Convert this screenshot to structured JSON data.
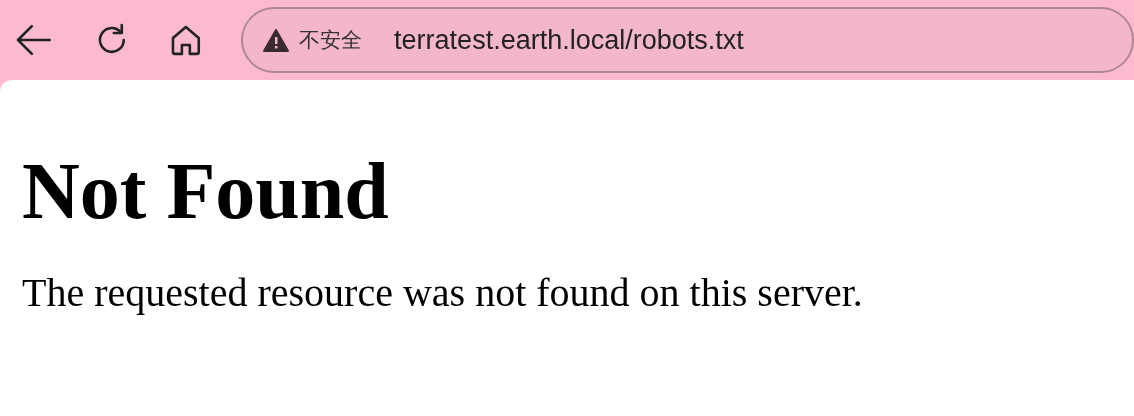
{
  "toolbar": {
    "security_label": "不安全",
    "url": "terratest.earth.local/robots.txt"
  },
  "page": {
    "heading": "Not Found",
    "message": "The requested resource was not found on this server."
  }
}
